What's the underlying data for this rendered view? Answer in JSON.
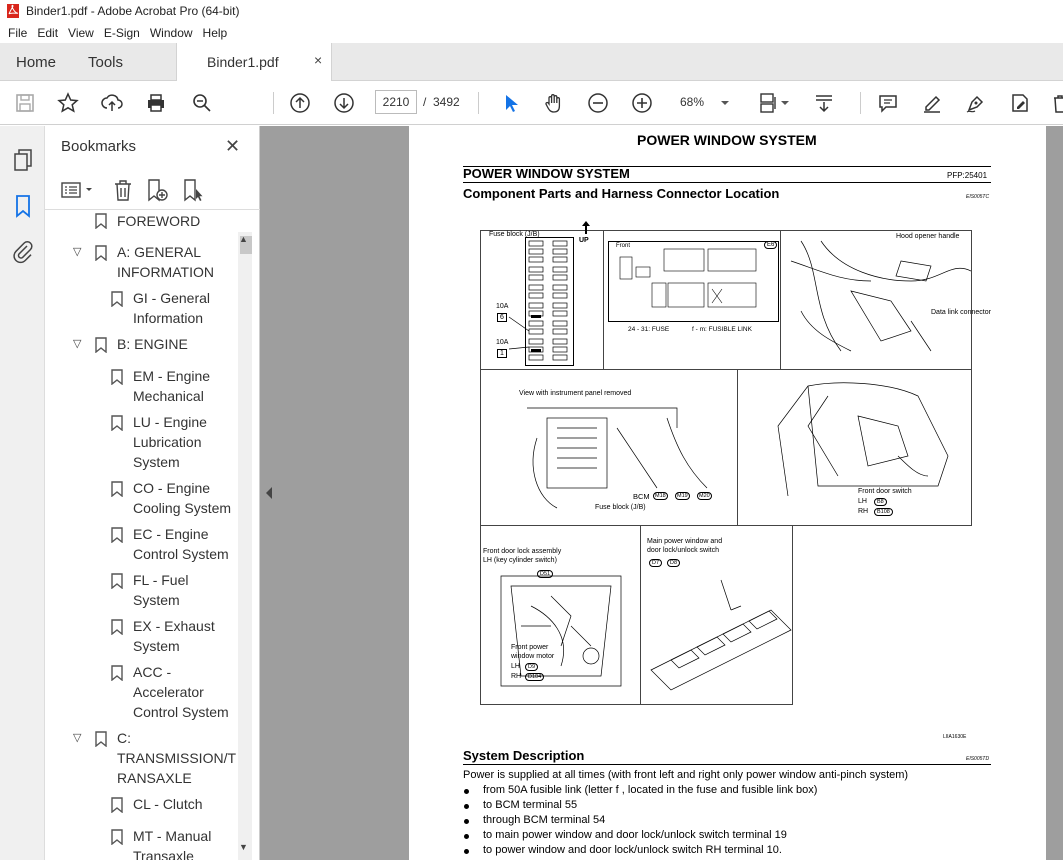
{
  "window": {
    "title": "Binder1.pdf - Adobe Acrobat Pro (64-bit)"
  },
  "menu": [
    "File",
    "Edit",
    "View",
    "E-Sign",
    "Window",
    "Help"
  ],
  "tabs": {
    "home": "Home",
    "tools": "Tools",
    "document": "Binder1.pdf",
    "close": "×"
  },
  "toolbar": {
    "page_current": "2210",
    "page_sep": "/",
    "page_total": "3492",
    "zoom": "68%"
  },
  "bookmarks": {
    "title": "Bookmarks",
    "close": "✕",
    "items": [
      {
        "label": "FOREWORD",
        "level": 1
      },
      {
        "label": "A: GENERAL INFORMATION",
        "lines": [
          "A: GENERAL",
          "INFORMATION"
        ],
        "level": 0
      },
      {
        "label": "GI - General Information",
        "lines": [
          "GI - General",
          "Information"
        ],
        "level": 1
      },
      {
        "label": "B: ENGINE",
        "lines": [
          "B: ENGINE"
        ],
        "level": 0
      },
      {
        "label": "EM - Engine Mechanical",
        "lines": [
          "EM - Engine",
          "Mechanical"
        ],
        "level": 1
      },
      {
        "label": "LU - Engine Lubrication System",
        "lines": [
          "LU - Engine",
          "Lubrication",
          "System"
        ],
        "level": 1
      },
      {
        "label": "CO - Engine Cooling System",
        "lines": [
          "CO - Engine",
          "Cooling System"
        ],
        "level": 1
      },
      {
        "label": "EC - Engine Control System",
        "lines": [
          "EC - Engine",
          "Control System"
        ],
        "level": 1
      },
      {
        "label": "FL - Fuel System",
        "lines": [
          "FL - Fuel",
          "System"
        ],
        "level": 1
      },
      {
        "label": "EX - Exhaust System",
        "lines": [
          "EX - Exhaust",
          "System"
        ],
        "level": 1
      },
      {
        "label": "ACC - Accelerator Control System",
        "lines": [
          "ACC -",
          "Accelerator",
          "Control System"
        ],
        "level": 1
      },
      {
        "label": "C: TRANSMISSION/TRANSAXLE",
        "lines": [
          "C:",
          "TRANSMISSION/T",
          "RANSAXLE"
        ],
        "level": 0
      },
      {
        "label": "CL - Clutch",
        "lines": [
          "CL - Clutch"
        ],
        "level": 1
      },
      {
        "label": "MT - Manual Transaxle",
        "lines": [
          "MT - Manual",
          "Transaxle"
        ],
        "level": 1
      }
    ]
  },
  "page": {
    "header": "POWER WINDOW SYSTEM",
    "section_title": "POWER WINDOW SYSTEM",
    "pfp": "PFP:25401",
    "subtitle": "Component Parts and Harness Connector Location",
    "code1": "EIS005TC",
    "fig_code": "LIIA1630E",
    "fig": {
      "fuse_block": "Fuse block (J/B)",
      "up": "UP",
      "f10a_1": "10A",
      "f6": "6",
      "f10a_2": "10A",
      "f1": "1",
      "front": "Front",
      "e6": "E6",
      "fuse_caption": "24 - 31: FUSE",
      "link_caption": "f - m: FUSIBLE LINK",
      "hood": "Hood opener handle",
      "dlc": "Data link connector",
      "view_ip": "View with instrument panel removed",
      "bcm": "BCM",
      "m18": "M18",
      "m19": "M19",
      "m20": "M20",
      "fuse_jb": "Fuse block (J/B)",
      "front_door_switch": "Front door switch",
      "lh": "LH",
      "rh": "RH",
      "b8": "B8",
      "b108": "B108",
      "front_lock": "Front door lock assembly",
      "front_lock2": "LH (key cylinder switch)",
      "d51": "D51",
      "motor1": "Front power",
      "motor2": "window motor",
      "d9": "D9",
      "d104": "D104",
      "main_sw1": "Main power window and",
      "main_sw2": "door lock/unlock switch",
      "d7": "D7",
      "d8": "D8"
    },
    "sysdesc_title": "System Description",
    "code2": "EIS005TD",
    "sysdesc_intro": "Power is supplied at all times (with front left and right only power window anti-pinch system)",
    "bullets": [
      "from 50A fusible link (letter f , located in the fuse and fusible link box)",
      "to BCM terminal 55",
      "through BCM terminal 54",
      "to main power window and door lock/unlock switch terminal 19",
      "to power window and door lock/unlock switch RH terminal 10."
    ]
  }
}
